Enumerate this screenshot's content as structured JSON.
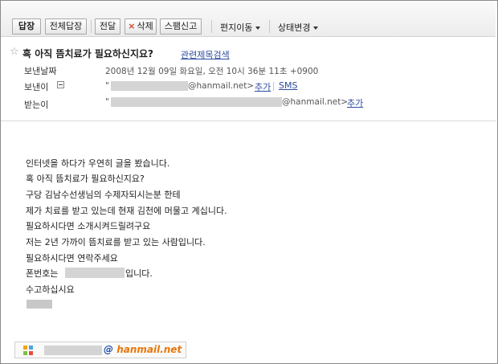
{
  "toolbar": {
    "reply": "답장",
    "reply_all": "전체답장",
    "forward": "전달",
    "delete": "삭제",
    "spam": "스팸신고",
    "move": "편지이동",
    "status": "상태변경"
  },
  "message": {
    "subject": "혹 아직 뜸치료가 필요하신지요?",
    "related_search": "관련제목검색",
    "labels": {
      "date": "보낸날짜",
      "from": "보낸이",
      "to": "받는이"
    },
    "date": "2008년 12월 09일 화요일, 오전 10시 36분 11초 +0900",
    "from_prefix": "\"",
    "from_domain": "@hanmail.net>",
    "to_prefix": "\"",
    "to_domain": "@hanmail.net>",
    "add": "추가",
    "sms": "SMS",
    "body": [
      "인터넷을 하다가 우연히 글을 봤습니다.",
      "혹 아직 뜸치료가 필요하신지요?",
      "구당 김남수선생님의 수제자되시는분 한테",
      "제가 치료를 받고 있는데 현재 김천에 머물고 계십니다.",
      "필요하시다면 소개시켜드릴려구요",
      "저는 2년 가까이 뜸치료를 받고 있는 사람입니다.",
      "필요하시다면 연락주세요",
      "폰번호는",
      "수고하십시요"
    ],
    "phone_suffix": "입니다."
  },
  "signature": {
    "at": "@",
    "domain": "hanmail.net"
  },
  "colors": {
    "link": "#2d4ba0",
    "delete_x": "#d2452b",
    "sig_orange": "#e8760b",
    "sig_blue": "#1f4fa8"
  }
}
